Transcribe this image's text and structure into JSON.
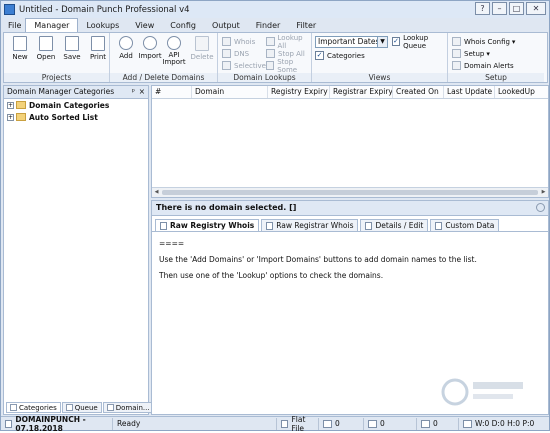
{
  "window": {
    "title": "Untitled - Domain Punch Professional v4",
    "buttons": [
      "?",
      "–",
      "□",
      "✕"
    ]
  },
  "menu": {
    "items": [
      "File",
      "Manager",
      "Lookups",
      "View",
      "Config",
      "Output",
      "Finder",
      "Filter"
    ],
    "active": "Manager"
  },
  "ribbon": {
    "projects": {
      "label": "Projects",
      "new": "New",
      "open": "Open",
      "save": "Save",
      "print": "Print"
    },
    "add_delete": {
      "label": "Add / Delete Domains",
      "add": "Add",
      "import": "Import",
      "api_import": "API\nImport",
      "delete": "Delete"
    },
    "lookups": {
      "label": "Domain Lookups",
      "whois": "Whois",
      "dns": "DNS",
      "selective": "Selective",
      "lookup_all": "Lookup All",
      "stop_all": "Stop All",
      "stop_some": "Stop Some"
    },
    "views": {
      "label": "Views",
      "view_select": "Important Dates",
      "lookup_queue": "Lookup Queue",
      "categories": "Categories"
    },
    "setup": {
      "label": "Setup",
      "whois_config": "Whois Config",
      "setup": "Setup",
      "domain_alerts": "Domain Alerts"
    }
  },
  "left_panel": {
    "title": "Domain Manager Categories",
    "pin": "ᵖ",
    "close": "×",
    "tree": [
      "Domain Categories",
      "Auto Sorted List"
    ],
    "tabs": [
      "Categories",
      "Queue",
      "Domain..."
    ]
  },
  "grid": {
    "columns": [
      "#",
      "Domain",
      "Registry Expiry",
      "Registrar Expiry",
      "Created On",
      "Last Update",
      "LookedUp"
    ]
  },
  "detail": {
    "header": "There is no domain selected. []",
    "tabs": [
      "Raw Registry Whois",
      "Raw Registrar Whois",
      "Details / Edit",
      "Custom Data"
    ],
    "body": [
      "====",
      "Use the 'Add Domains' or 'Import Domains' buttons to add domain names to the list.",
      "Then use one of the 'Lookup' options to check the domains."
    ]
  },
  "status": {
    "product": "DOMAINPUNCH - 07.18.2018",
    "state": "Ready",
    "file": "Flat File",
    "count1": "0",
    "count2": "0",
    "count3": "0",
    "counters": "W:0 D:0 H:0 P:0"
  },
  "colors": {
    "accent": "#3d7fd2",
    "ribbon_bg": "#f7f9fc",
    "panel_border": "#a9bbd3"
  }
}
